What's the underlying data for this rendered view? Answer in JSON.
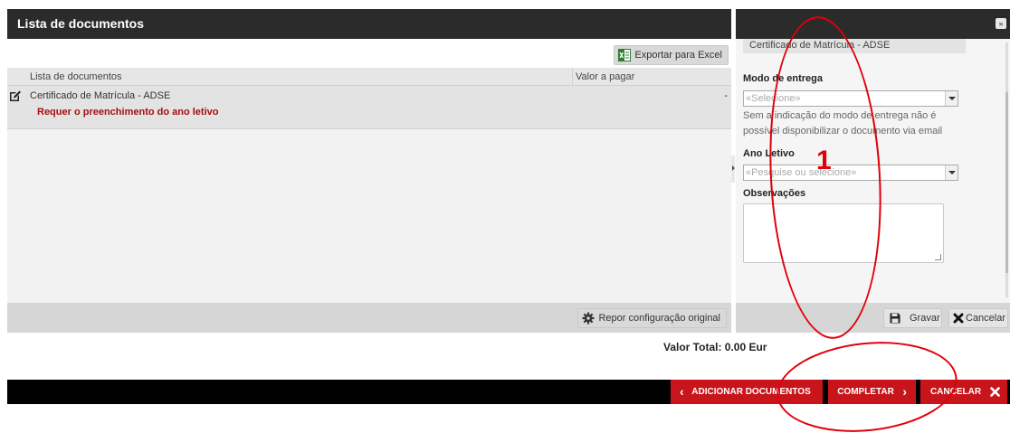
{
  "left_panel": {
    "title": "Lista de documentos",
    "export_button": "Exportar para Excel",
    "columns": [
      "Lista de documentos",
      "Valor a pagar"
    ],
    "rows": [
      {
        "name": "Certificado de Matrícula - ADSE",
        "value": "-",
        "warning": "Requer o preenchimento do ano letivo"
      }
    ],
    "reset_button": "Repor configuração original"
  },
  "right_panel": {
    "document": "Certificado de Matrícula - ADSE",
    "delivery_label": "Modo de entrega",
    "delivery_placeholder": "«Selecione»",
    "delivery_info": "Sem a indicação do modo de entrega não é possível disponibilizar o documento via email",
    "year_label": "Ano Letivo",
    "year_placeholder": "«Pesquise ou selecione»",
    "notes_label": "Observações",
    "save_button": "Gravar",
    "cancel_button": "Cancelar"
  },
  "total": "Valor Total: 0.00 Eur",
  "actions": {
    "add_documents": "ADICIONAR DOCUMENTOS",
    "complete": "COMPLETAR",
    "cancel": "CANCELAR"
  },
  "annotations": {
    "marker_1": "1",
    "color": "#e0000a"
  },
  "colors": {
    "header": "#2b2b2b",
    "action_red": "#c8151b",
    "warning_text": "#a50e0e"
  }
}
